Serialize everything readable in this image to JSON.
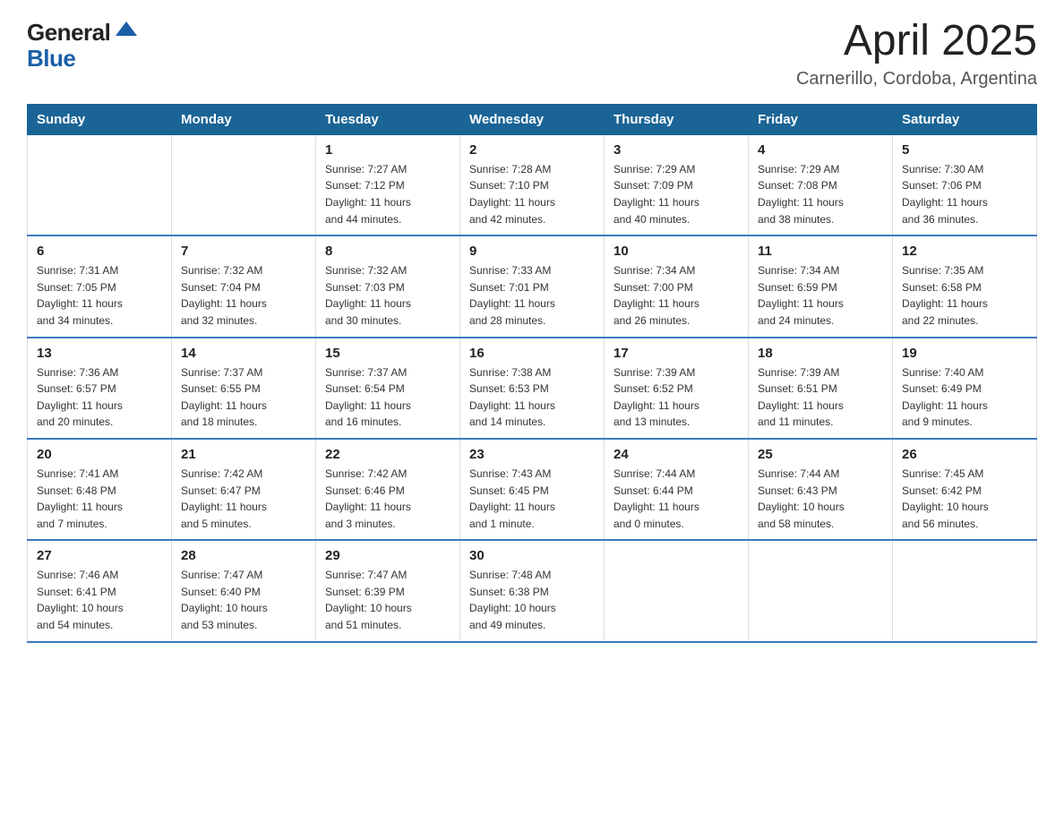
{
  "header": {
    "logo_line1": "General",
    "logo_line2": "Blue",
    "month_title": "April 2025",
    "location": "Carnerillo, Cordoba, Argentina"
  },
  "days_of_week": [
    "Sunday",
    "Monday",
    "Tuesday",
    "Wednesday",
    "Thursday",
    "Friday",
    "Saturday"
  ],
  "weeks": [
    [
      {
        "day": "",
        "info": ""
      },
      {
        "day": "",
        "info": ""
      },
      {
        "day": "1",
        "info": "Sunrise: 7:27 AM\nSunset: 7:12 PM\nDaylight: 11 hours\nand 44 minutes."
      },
      {
        "day": "2",
        "info": "Sunrise: 7:28 AM\nSunset: 7:10 PM\nDaylight: 11 hours\nand 42 minutes."
      },
      {
        "day": "3",
        "info": "Sunrise: 7:29 AM\nSunset: 7:09 PM\nDaylight: 11 hours\nand 40 minutes."
      },
      {
        "day": "4",
        "info": "Sunrise: 7:29 AM\nSunset: 7:08 PM\nDaylight: 11 hours\nand 38 minutes."
      },
      {
        "day": "5",
        "info": "Sunrise: 7:30 AM\nSunset: 7:06 PM\nDaylight: 11 hours\nand 36 minutes."
      }
    ],
    [
      {
        "day": "6",
        "info": "Sunrise: 7:31 AM\nSunset: 7:05 PM\nDaylight: 11 hours\nand 34 minutes."
      },
      {
        "day": "7",
        "info": "Sunrise: 7:32 AM\nSunset: 7:04 PM\nDaylight: 11 hours\nand 32 minutes."
      },
      {
        "day": "8",
        "info": "Sunrise: 7:32 AM\nSunset: 7:03 PM\nDaylight: 11 hours\nand 30 minutes."
      },
      {
        "day": "9",
        "info": "Sunrise: 7:33 AM\nSunset: 7:01 PM\nDaylight: 11 hours\nand 28 minutes."
      },
      {
        "day": "10",
        "info": "Sunrise: 7:34 AM\nSunset: 7:00 PM\nDaylight: 11 hours\nand 26 minutes."
      },
      {
        "day": "11",
        "info": "Sunrise: 7:34 AM\nSunset: 6:59 PM\nDaylight: 11 hours\nand 24 minutes."
      },
      {
        "day": "12",
        "info": "Sunrise: 7:35 AM\nSunset: 6:58 PM\nDaylight: 11 hours\nand 22 minutes."
      }
    ],
    [
      {
        "day": "13",
        "info": "Sunrise: 7:36 AM\nSunset: 6:57 PM\nDaylight: 11 hours\nand 20 minutes."
      },
      {
        "day": "14",
        "info": "Sunrise: 7:37 AM\nSunset: 6:55 PM\nDaylight: 11 hours\nand 18 minutes."
      },
      {
        "day": "15",
        "info": "Sunrise: 7:37 AM\nSunset: 6:54 PM\nDaylight: 11 hours\nand 16 minutes."
      },
      {
        "day": "16",
        "info": "Sunrise: 7:38 AM\nSunset: 6:53 PM\nDaylight: 11 hours\nand 14 minutes."
      },
      {
        "day": "17",
        "info": "Sunrise: 7:39 AM\nSunset: 6:52 PM\nDaylight: 11 hours\nand 13 minutes."
      },
      {
        "day": "18",
        "info": "Sunrise: 7:39 AM\nSunset: 6:51 PM\nDaylight: 11 hours\nand 11 minutes."
      },
      {
        "day": "19",
        "info": "Sunrise: 7:40 AM\nSunset: 6:49 PM\nDaylight: 11 hours\nand 9 minutes."
      }
    ],
    [
      {
        "day": "20",
        "info": "Sunrise: 7:41 AM\nSunset: 6:48 PM\nDaylight: 11 hours\nand 7 minutes."
      },
      {
        "day": "21",
        "info": "Sunrise: 7:42 AM\nSunset: 6:47 PM\nDaylight: 11 hours\nand 5 minutes."
      },
      {
        "day": "22",
        "info": "Sunrise: 7:42 AM\nSunset: 6:46 PM\nDaylight: 11 hours\nand 3 minutes."
      },
      {
        "day": "23",
        "info": "Sunrise: 7:43 AM\nSunset: 6:45 PM\nDaylight: 11 hours\nand 1 minute."
      },
      {
        "day": "24",
        "info": "Sunrise: 7:44 AM\nSunset: 6:44 PM\nDaylight: 11 hours\nand 0 minutes."
      },
      {
        "day": "25",
        "info": "Sunrise: 7:44 AM\nSunset: 6:43 PM\nDaylight: 10 hours\nand 58 minutes."
      },
      {
        "day": "26",
        "info": "Sunrise: 7:45 AM\nSunset: 6:42 PM\nDaylight: 10 hours\nand 56 minutes."
      }
    ],
    [
      {
        "day": "27",
        "info": "Sunrise: 7:46 AM\nSunset: 6:41 PM\nDaylight: 10 hours\nand 54 minutes."
      },
      {
        "day": "28",
        "info": "Sunrise: 7:47 AM\nSunset: 6:40 PM\nDaylight: 10 hours\nand 53 minutes."
      },
      {
        "day": "29",
        "info": "Sunrise: 7:47 AM\nSunset: 6:39 PM\nDaylight: 10 hours\nand 51 minutes."
      },
      {
        "day": "30",
        "info": "Sunrise: 7:48 AM\nSunset: 6:38 PM\nDaylight: 10 hours\nand 49 minutes."
      },
      {
        "day": "",
        "info": ""
      },
      {
        "day": "",
        "info": ""
      },
      {
        "day": "",
        "info": ""
      }
    ]
  ]
}
